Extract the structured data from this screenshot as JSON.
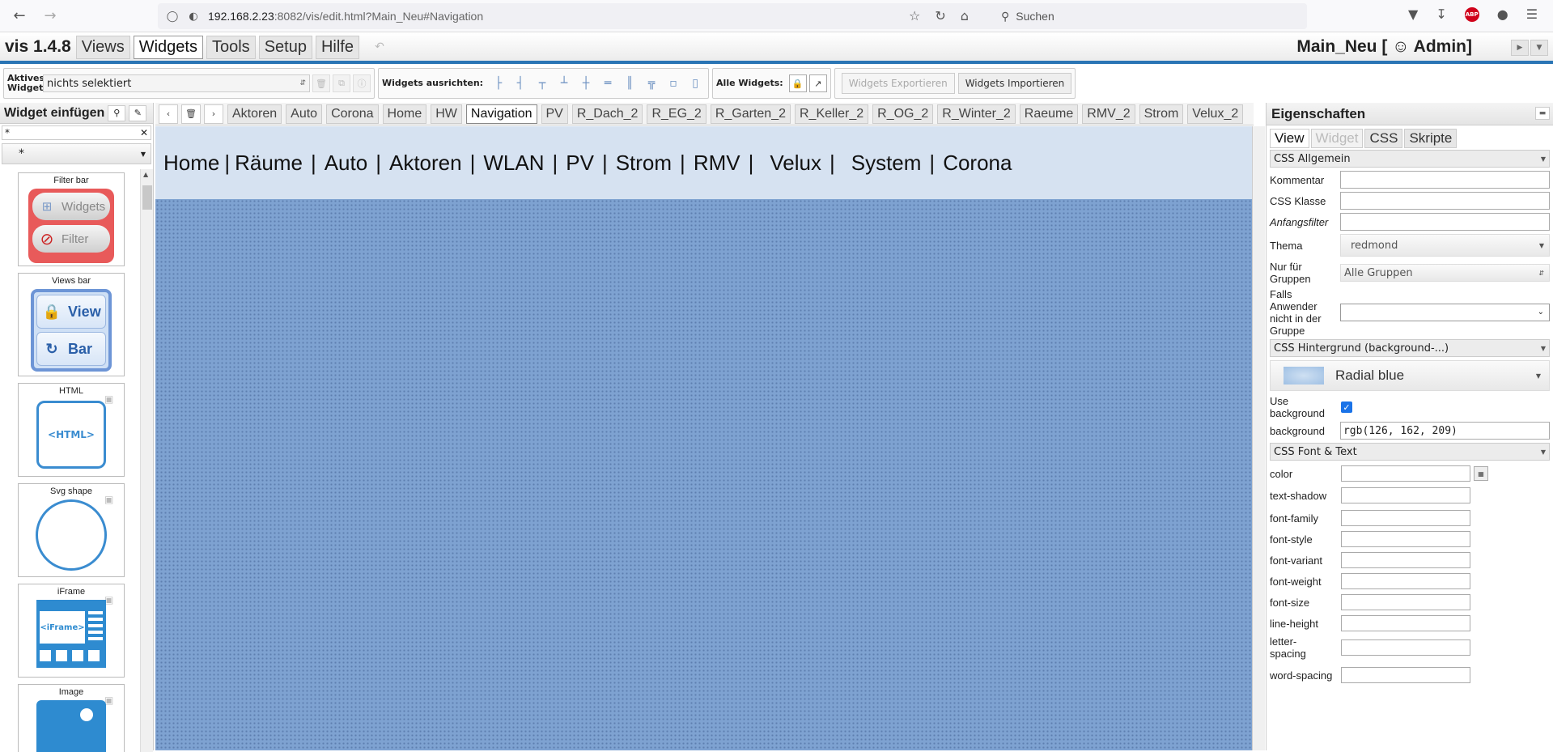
{
  "browser": {
    "url_host": "192.168.2.23",
    "url_rest": ":8082/vis/edit.html?Main_Neu#Navigation",
    "search_placeholder": "Suchen",
    "abp_label": "ABP"
  },
  "menu": {
    "app_title": "vis 1.4.8",
    "tabs": [
      "Views",
      "Widgets",
      "Tools",
      "Setup",
      "Hilfe"
    ],
    "active_tab": "Widgets",
    "project_title": "Main_Neu [ ☺ Admin]"
  },
  "toolbar": {
    "active_widget_label": "Aktives Widget:",
    "active_widget_value": "nichts selektiert",
    "align_label": "Widgets ausrichten:",
    "all_widgets_label": "Alle Widgets:",
    "export_label": "Widgets Exportieren",
    "import_label": "Widgets Importieren"
  },
  "left_panel": {
    "title": "Widget einfügen",
    "filter_value": "*",
    "set_value": "*",
    "widgets": [
      {
        "name": "Filter bar",
        "btn1": "Widgets",
        "btn2": "Filter"
      },
      {
        "name": "Views bar",
        "btn1": "View",
        "btn2": "Bar"
      },
      {
        "name": "HTML",
        "label": "<HTML>"
      },
      {
        "name": "Svg shape"
      },
      {
        "name": "iFrame",
        "label": "<iFrame>"
      },
      {
        "name": "Image"
      }
    ]
  },
  "view_tabs": [
    "Aktoren",
    "Auto",
    "Corona",
    "Home",
    "HW",
    "Navigation",
    "PV",
    "R_Dach_2",
    "R_EG_2",
    "R_Garten_2",
    "R_Keller_2",
    "R_OG_2",
    "R_Winter_2",
    "Raeume",
    "RMV_2",
    "Strom",
    "Velux_2"
  ],
  "active_view": "Navigation",
  "navigation": [
    "Home",
    "Räume",
    "Auto",
    "Aktoren",
    "WLAN",
    "PV",
    "Strom",
    "RMV",
    "Velux",
    "System",
    "Corona"
  ],
  "nav_separator": "|",
  "right_panel": {
    "title": "Eigenschaften",
    "tabs": [
      "View",
      "Widget",
      "CSS",
      "Skripte"
    ],
    "section_general": "CSS Allgemein",
    "kommentar_label": "Kommentar",
    "css_klasse_label": "CSS Klasse",
    "anfangsfilter_label": "Anfangsfilter",
    "thema_label": "Thema",
    "thema_value": "redmond",
    "gruppen_label": "Nur für Gruppen",
    "gruppen_value": "Alle Gruppen",
    "falls_label": "Falls Anwender nicht in der Gruppe",
    "section_background": "CSS Hintergrund (background-...)",
    "bg_name": "Radial blue",
    "use_background_label": "Use background",
    "background_label": "background",
    "background_value": "rgb(126, 162, 209)",
    "section_font": "CSS Font & Text",
    "font_props": [
      "color",
      "text-shadow",
      "font-family",
      "font-style",
      "font-variant",
      "font-weight",
      "font-size",
      "line-height",
      "letter-spacing",
      "word-spacing"
    ]
  },
  "colors": {
    "canvas_bg": "#7ea2d1",
    "nav_bg": "#d6e2f1",
    "menu_accent": "#2a75b5"
  }
}
